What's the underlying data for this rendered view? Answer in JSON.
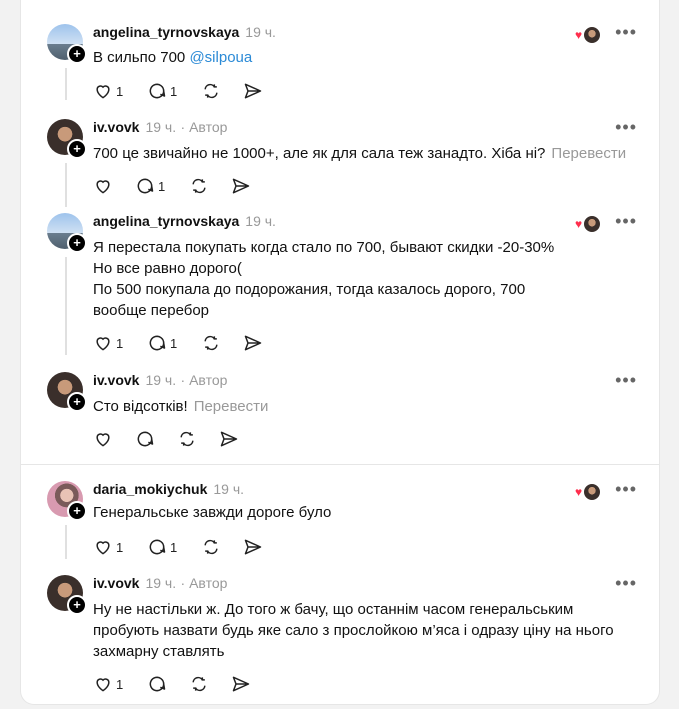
{
  "posts": [
    {
      "user": "angelina_tyrnovskaya",
      "time": "19 ч.",
      "author": "",
      "text": "В сильпо 700 ",
      "mention": "@silpoua",
      "translate": "",
      "likes": "1",
      "replies": "1"
    },
    {
      "user": "iv.vovk",
      "time": "19 ч.",
      "author": "· Автор",
      "text": "700 це звичайно не 1000+, але як для сала теж занадто. Хіба ні?",
      "translate": "Перевести",
      "likes": "",
      "replies": "1"
    },
    {
      "user": "angelina_tyrnovskaya",
      "time": "19 ч.",
      "author": "",
      "lines": [
        "Я перестала покупать когда стало по 700, бывают скидки -20-30%",
        "Но все равно дорого(",
        "По 500 покупала до подорожания, тогда казалось дорого, 700",
        "вообще перебор"
      ],
      "likes": "1",
      "replies": "1"
    },
    {
      "user": "iv.vovk",
      "time": "19 ч.",
      "author": "· Автор",
      "text": "Сто відсотків!",
      "translate": "Перевести",
      "likes": "",
      "replies": ""
    },
    {
      "user": "daria_mokiychuk",
      "time": "19 ч.",
      "author": "",
      "text": "Генеральське завжди дороге було",
      "likes": "1",
      "replies": "1"
    },
    {
      "user": "iv.vovk",
      "time": "19 ч.",
      "author": "· Автор",
      "lines": [
        "Ну не настільки ж. До того ж бачу, що останнім часом генеральським",
        "пробують назвати будь яке сало з прослойкою м’яса і одразу ціну на нього",
        "захмарну ставлять"
      ],
      "likes": "1",
      "replies": ""
    }
  ],
  "icons": {
    "more": "more-dots-icon",
    "like": "heart-icon",
    "reply": "comment-icon",
    "repost": "repost-icon",
    "share": "share-icon",
    "follow": "plus-icon"
  },
  "colors": {
    "mention": "#2b8ad6",
    "heart": "#ff2e4d"
  }
}
